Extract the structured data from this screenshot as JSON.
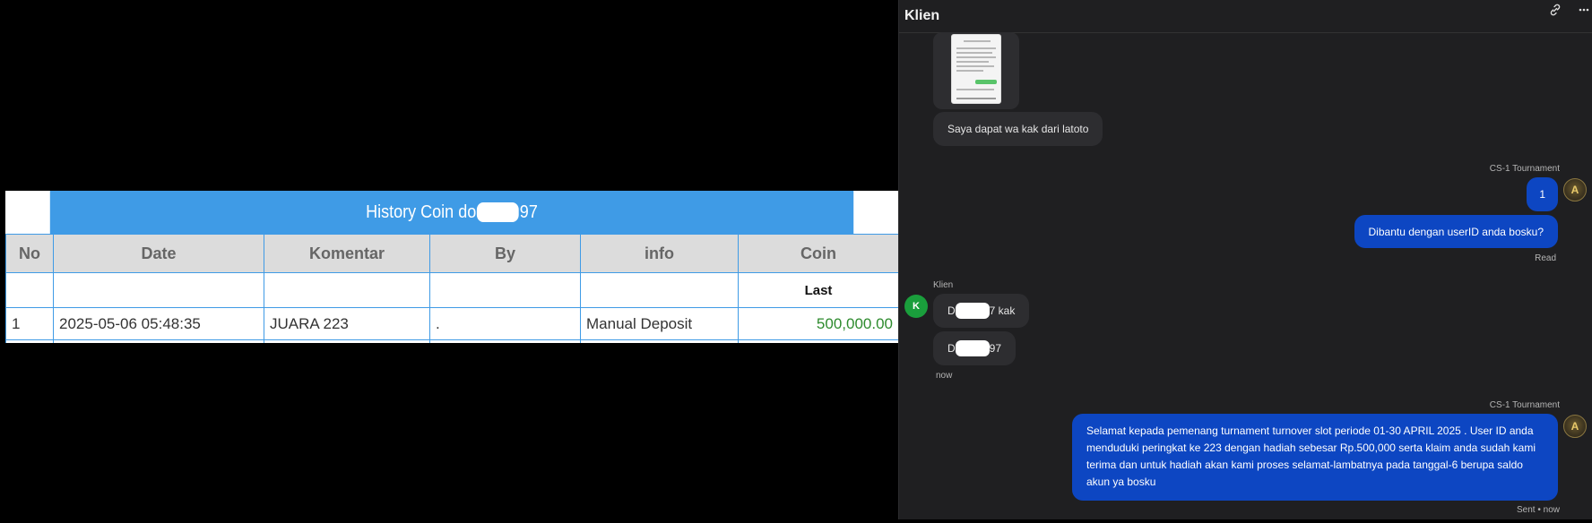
{
  "history": {
    "title_prefix": "History Coin do",
    "title_suffix": "97",
    "columns": [
      "No",
      "Date",
      "Komentar",
      "By",
      "info",
      "Coin"
    ],
    "subheader": "Last",
    "rows": [
      {
        "no": "1",
        "date": "2025-05-06 05:48:35",
        "komentar": "JUARA 223",
        "by": ".",
        "info": "Manual Deposit",
        "coin": "500,000.00"
      }
    ]
  },
  "chat": {
    "title": "Klien",
    "header_icons": [
      "link-icon",
      "more-icon"
    ],
    "messages": {
      "client1_text": "Saya dapat wa kak dari latoto",
      "agent1_sender": "CS-1 Tournament",
      "agent1_msg1": "1",
      "agent1_msg2": "Dibantu dengan userID anda bosku?",
      "agent1_status": "Read",
      "client2_sender": "Klien",
      "client2_avatar": "K",
      "client2_msg1_prefix": "D",
      "client2_msg1_suffix": "7 kak",
      "client2_msg2_prefix": "D",
      "client2_msg2_suffix": "97",
      "client2_time": "now",
      "agent2_sender": "CS-1 Tournament",
      "agent2_text": "Selamat kepada pemenang turnament turnover slot periode 01-30 APRIL 2025 . User ID anda menduduki peringkat ke 223 dengan hadiah sebesar Rp.500,000 serta klaim anda sudah kami terima dan untuk hadiah akan kami proses selamat-lambatnya pada tanggal-6 berupa saldo akun ya bosku",
      "agent2_status": "Sent • now"
    }
  },
  "colors": {
    "table_header_blue": "#3f9be6",
    "coin_green": "#2e8b2e",
    "chat_bg": "#1f1f21",
    "bubble_out": "#0d46c2",
    "bubble_in": "#2d2d30",
    "client_avatar": "#1a9e3c"
  }
}
